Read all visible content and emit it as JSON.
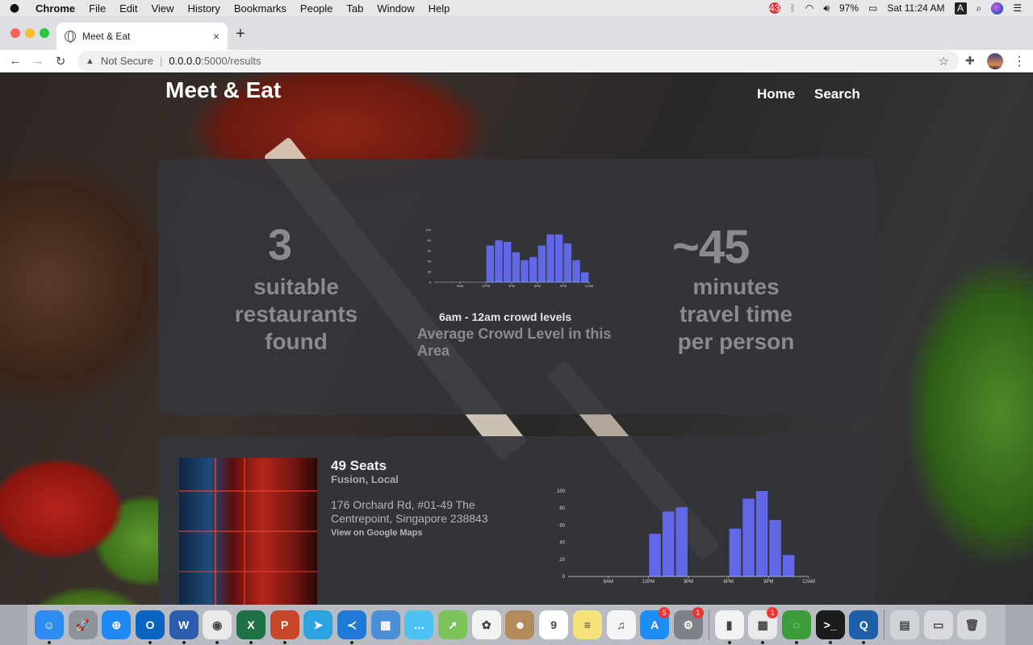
{
  "menubar": {
    "app": "Chrome",
    "items": [
      "File",
      "Edit",
      "View",
      "History",
      "Bookmarks",
      "People",
      "Tab",
      "Window",
      "Help"
    ],
    "battery": "97%",
    "clock": "Sat 11:24 AM",
    "input_source": "A",
    "notification_badge": "43"
  },
  "browser": {
    "tab_title": "Meet & Eat",
    "tab_close": "×",
    "new_tab": "+",
    "not_secure": "Not Secure",
    "url_host": "0.0.0.0",
    "url_path": ":5000/results"
  },
  "site": {
    "brand": "Meet & Eat",
    "nav": {
      "home": "Home",
      "search": "Search"
    }
  },
  "summary": {
    "count": "3",
    "count_label": [
      "suitable",
      "restaurants",
      "found"
    ],
    "chart_caption": "6am - 12am crowd levels",
    "chart_subcaption": "Average Crowd Level in this Area",
    "travel": "~45",
    "travel_label": [
      "minutes",
      "travel time",
      "per person"
    ]
  },
  "restaurant": {
    "name": "49 Seats",
    "cuisine": "Fusion, Local",
    "address": "176 Orchard Rd, #01-49 The Centrepoint, Singapore 238843",
    "maps_link": "View on Google Maps"
  },
  "chart_data": [
    {
      "type": "bar",
      "title": "",
      "x_tick_labels": [
        "9AM",
        "12PM",
        "3PM",
        "6PM",
        "9PM",
        "12AM"
      ],
      "y_ticks": [
        0,
        20,
        40,
        60,
        80,
        100
      ],
      "ylim": [
        0,
        100
      ],
      "bar_color": "#6068e8",
      "x": [
        6,
        7,
        8,
        9,
        10,
        11,
        12,
        13,
        14,
        15,
        16,
        17,
        18,
        19,
        20,
        21,
        22,
        23
      ],
      "values": [
        0,
        0,
        0,
        0,
        0,
        0,
        70,
        80,
        77,
        57,
        42,
        48,
        70,
        91,
        91,
        74,
        42,
        19
      ]
    },
    {
      "type": "bar",
      "title": "",
      "x_tick_labels": [
        "9AM",
        "12PM",
        "3PM",
        "6PM",
        "9PM",
        "12AM"
      ],
      "y_ticks": [
        0,
        20,
        40,
        60,
        80,
        100
      ],
      "ylim": [
        0,
        100
      ],
      "bar_color": "#6068e8",
      "x": [
        6,
        7,
        8,
        9,
        10,
        11,
        12,
        13,
        14,
        15,
        16,
        17,
        18,
        19,
        20,
        21,
        22,
        23
      ],
      "values": [
        0,
        0,
        0,
        0,
        0,
        0,
        50,
        76,
        81,
        0,
        0,
        0,
        56,
        91,
        100,
        66,
        25,
        0
      ]
    }
  ],
  "dock": {
    "apps": [
      {
        "icon": "finder-icon",
        "color": "#2e8bf0",
        "glyph": "☺",
        "dot": true
      },
      {
        "icon": "launchpad-icon",
        "color": "#8e949c",
        "glyph": "🚀"
      },
      {
        "icon": "safari-icon",
        "color": "#1e88f5",
        "glyph": "⊕"
      },
      {
        "icon": "outlook-icon",
        "color": "#0a64c2",
        "glyph": "O",
        "dot": true
      },
      {
        "icon": "word-icon",
        "color": "#2b5cad",
        "glyph": "W",
        "dot": true
      },
      {
        "icon": "chrome-icon",
        "color": "#e9e9e9",
        "glyph": "◉",
        "dot": true
      },
      {
        "icon": "excel-icon",
        "color": "#1f7244",
        "glyph": "X",
        "dot": true
      },
      {
        "icon": "powerpoint-icon",
        "color": "#c8472b",
        "glyph": "P",
        "dot": true
      },
      {
        "icon": "telegram-icon",
        "color": "#2aa3e0",
        "glyph": "➤"
      },
      {
        "icon": "vscode-icon",
        "color": "#1f7ad6",
        "glyph": "≺",
        "dot": true
      },
      {
        "icon": "preview-icon",
        "color": "#4b8fd6",
        "glyph": "▦"
      },
      {
        "icon": "messages-icon",
        "color": "#4fc2f5",
        "glyph": "…"
      },
      {
        "icon": "maps-icon",
        "color": "#7cc35a",
        "glyph": "➚"
      },
      {
        "icon": "photos-icon",
        "color": "#f2f2f2",
        "glyph": "✿"
      },
      {
        "icon": "contacts-icon",
        "color": "#b38a5a",
        "glyph": "☻"
      },
      {
        "icon": "calendar-icon",
        "color": "#ffffff",
        "glyph": "9"
      },
      {
        "icon": "notes-icon",
        "color": "#f6e27a",
        "glyph": "≡"
      },
      {
        "icon": "music-icon",
        "color": "#f5f5f7",
        "glyph": "♫"
      },
      {
        "icon": "app-store-icon",
        "color": "#1c8ef5",
        "glyph": "A",
        "badge": "5"
      },
      {
        "icon": "system-preferences-icon",
        "color": "#7d8288",
        "glyph": "⚙",
        "badge": "1"
      },
      {
        "sep": true
      },
      {
        "icon": "numbers-icon",
        "color": "#f2f2f2",
        "glyph": "▮",
        "dot": true
      },
      {
        "icon": "microsoft-autoupdate-icon",
        "color": "#e9e9e9",
        "glyph": "▦",
        "badge": "1",
        "dot": true
      },
      {
        "icon": "sync-icon",
        "color": "#3c9d3c",
        "glyph": "◌",
        "dot": true
      },
      {
        "icon": "terminal-icon",
        "color": "#1b1b1b",
        "glyph": ">_",
        "dot": true
      },
      {
        "icon": "quicktime-icon",
        "color": "#1d5fa8",
        "glyph": "Q",
        "dot": true
      },
      {
        "sep": true
      },
      {
        "icon": "downloads-folder-icon",
        "color": "#cfd3d8",
        "glyph": "▤"
      },
      {
        "icon": "desktop-stack-icon",
        "color": "#d8dadf",
        "glyph": "▭"
      },
      {
        "icon": "trash-icon",
        "color": "#d6d8dc",
        "glyph": "🗑"
      }
    ]
  }
}
